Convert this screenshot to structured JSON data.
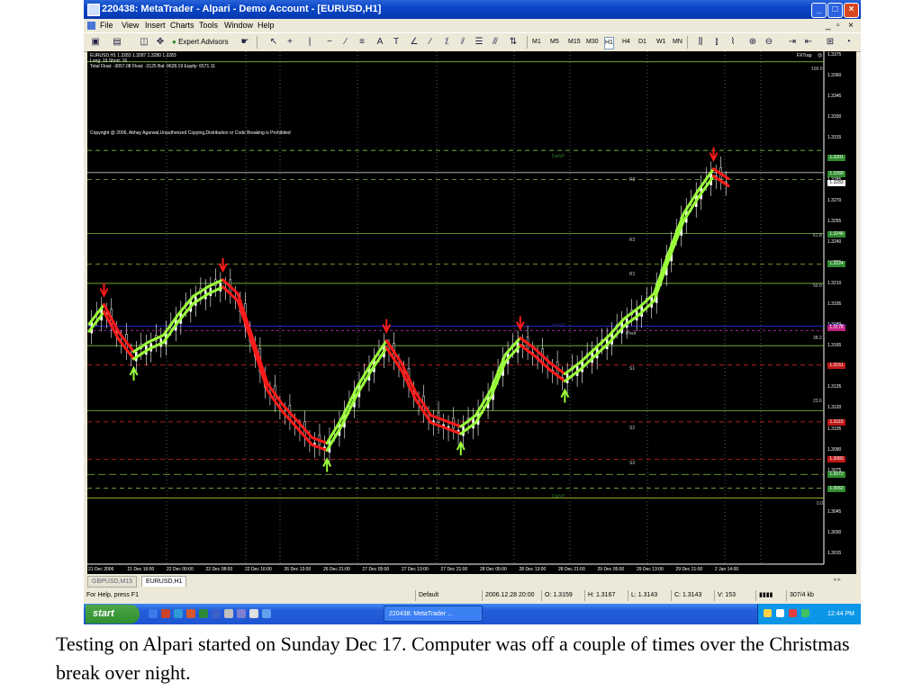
{
  "window": {
    "title": "220438: MetaTrader - Alpari - Demo Account - [EURUSD,H1]",
    "minimize_glyph": "_",
    "maximize_glyph": "□",
    "close_glyph": "×"
  },
  "menu": [
    "File",
    "View",
    "Insert",
    "Charts",
    "Tools",
    "Window",
    "Help"
  ],
  "mdi_controls": [
    "_",
    "▫",
    "×"
  ],
  "toolbar": {
    "expert_advisors_label": "Expert Advisors",
    "timeframes": [
      "M1",
      "M5",
      "M15",
      "M30",
      "H1",
      "H4",
      "D1",
      "W1",
      "MN"
    ],
    "selected_timeframe": "H1"
  },
  "chart": {
    "symbol_line": "EURUSD,H1  1.3283 1.3287 1.3280 1.3283",
    "long_short": "Long: 19 Short: 16",
    "totals": "Total Float: -3057.08 Float: -3125 Bal: 9628.19 Equity: 6571.11",
    "copyright": "Copyright @ 2006, Abhay Agarwal,Unauthorized Copying,Distribution or Code Breaking is Prohibited",
    "indicator_tag": "FXTrap",
    "fib_100": "100.0",
    "fib_618": "61.8",
    "fib_50": "50.0",
    "fib_382": "38.2",
    "fib_236": "23.6",
    "fib_0": "0.0",
    "r3": "R3",
    "r2": "R2",
    "r1": "R1",
    "pivot": "Pivot",
    "s1": "S1",
    "s2": "S2",
    "s3": "S3",
    "dailyp_top": "DailyP",
    "dailyp_mid": "DailyP",
    "dailyp_bottom": "DailyP",
    "price_ticks": [
      "1.3375",
      "1.3360",
      "1.3345",
      "1.3330",
      "1.3315",
      "1.3300",
      "1.3285",
      "1.3270",
      "1.3255",
      "1.3240",
      "1.3225",
      "1.3210",
      "1.3195",
      "1.3180",
      "1.3165",
      "1.3150",
      "1.3135",
      "1.3120",
      "1.3105",
      "1.3090",
      "1.3075",
      "1.3060",
      "1.3045",
      "1.3030",
      "1.3015"
    ],
    "price_boxes": [
      {
        "text": "1.3301",
        "color": "#2e8b2e"
      },
      {
        "text": "1.3289",
        "color": "#2e8b2e"
      },
      {
        "text": "1.3283",
        "color": "#ffffff"
      },
      {
        "text": "1.3246",
        "color": "#2e8b2e"
      },
      {
        "text": "1.3224",
        "color": "#2e8b2e"
      },
      {
        "text": "1.3179",
        "color": "#1a1ab0"
      },
      {
        "text": "1.3178",
        "color": "#c02080"
      },
      {
        "text": "1.3151",
        "color": "#c01818"
      },
      {
        "text": "1.3110",
        "color": "#c01818"
      },
      {
        "text": "1.3083",
        "color": "#c01818"
      },
      {
        "text": "1.3072",
        "color": "#2e8b2e"
      },
      {
        "text": "1.3062",
        "color": "#2e8b2e"
      }
    ],
    "time_ticks": [
      "21 Dec 2006",
      "21 Dec 16:00",
      "22 Dec 00:00",
      "22 Dec 08:00",
      "22 Dec 16:00",
      "26 Dec 13:00",
      "26 Dec 21:00",
      "27 Dec 05:00",
      "27 Dec 13:00",
      "27 Dec 21:00",
      "28 Dec 05:00",
      "28 Dec 13:00",
      "28 Dec 21:00",
      "29 Dec 05:00",
      "29 Dec 13:00",
      "29 Dec 21:00",
      "2 Jan 14:00"
    ],
    "price_series": [
      1.3178,
      1.3192,
      1.3172,
      1.3158,
      1.3165,
      1.317,
      1.3185,
      1.3198,
      1.3205,
      1.321,
      1.32,
      1.3168,
      1.3135,
      1.312,
      1.3108,
      1.3096,
      1.3092,
      1.311,
      1.3132,
      1.315,
      1.3166,
      1.315,
      1.3128,
      1.3112,
      1.3108,
      1.3104,
      1.3112,
      1.313,
      1.3156,
      1.3168,
      1.316,
      1.315,
      1.3142,
      1.315,
      1.316,
      1.317,
      1.3182,
      1.319,
      1.32,
      1.323,
      1.3258,
      1.3275,
      1.329,
      1.3283
    ],
    "colors": {
      "up_trend": "#9aff3a",
      "down_trend": "#ff1a1a",
      "candle": "#ffffff",
      "level_green": "#7fbf3f",
      "level_red": "#d02020",
      "pivot_blue": "#3030ff",
      "pivot_magenta": "#d030d0"
    }
  },
  "tabs": [
    "GBPUSD,M15",
    "EURUSD,H1"
  ],
  "active_tab": "EURUSD,H1",
  "status": {
    "help": "For Help, press F1",
    "profile": "Default",
    "datetime": "2006.12.28 20:00",
    "open": "O: 1.3159",
    "high": "H: 1.3167",
    "low": "L: 1.3143",
    "close": "C: 1.3143",
    "volume": "V: 153",
    "traffic": "307/4 kb"
  },
  "taskbar": {
    "start": "start",
    "task": "220438: MetaTrader ...",
    "clock": "12:44 PM"
  },
  "caption": "Testing on Alpari started on Sunday Dec 17.  Computer was off a couple of times over the Christmas break over night."
}
